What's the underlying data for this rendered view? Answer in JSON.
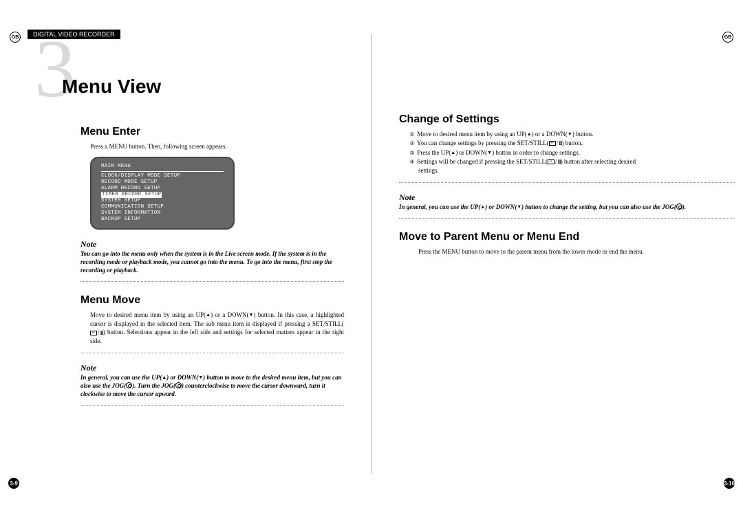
{
  "header": {
    "lang_label": "GB",
    "doc_title": "DIGITAL VIDEO RECORDER"
  },
  "chapter": {
    "number": "3",
    "title": "Menu View"
  },
  "page_numbers": {
    "left": "3-9",
    "right": "3-10"
  },
  "left": {
    "section1": {
      "title": "Menu Enter",
      "text": "Press a MENU button. Then, following screen appears.",
      "monitor": {
        "title": "MAIN MENU",
        "lines": [
          "CLOCK/DISPLAY MODE SETUP",
          "RECORD MODE SETUP",
          "ALARM RECORD SETUP",
          "TIMER RECORD SETUP",
          "SYSTEM SETUP",
          "COMMUNICATION SETUP",
          "SYSTEM INFORMATION",
          "BACKUP SETUP"
        ],
        "highlight_index": 3
      },
      "note_label": "Note",
      "note_text": "You can go into the menu only when the system is in the Live screen mode. If the system is in the recording mode or playback mode, you cannot go into the menu. To go into the menu, first stop the recording or playback."
    },
    "section2": {
      "title": "Menu Move",
      "text_a": "Move to desired menu item by using an UP(",
      "text_b": ") or a DOWN(",
      "text_c": ") button. In this case, a highlighted cursor is displayed in the selected item. The sub menu item is displayed if pressing a SET/STILL(",
      "text_d": ") button. Selections appear in the left side and settings for selected matters appear in the right side.",
      "note_label": "Note",
      "note_a": "In general, you can use the UP(",
      "note_b": ") or DOWN(",
      "note_c": ") button to move to the desired menu item, but you can also use the JOG(",
      "note_d": "). Turn the JOG(",
      "note_e": ") counterclockwise to move the cursor downward, turn it clockwise to move the cursor upward."
    }
  },
  "right": {
    "section1": {
      "title": "Change of Settings",
      "line1a": "Move to desired menu item by using an UP(",
      "line1b": ") or a DOWN(",
      "line1c": ") button.",
      "line2a": "You can change settings by pressing the SET/STILL(",
      "line2b": ") button.",
      "line3a": "Press the UP(",
      "line3b": ") or DOWN(",
      "line3c": ") button in order to change settings.",
      "line4a": "Settings will be changed if pressing the SET/STILL(",
      "line4b": ") button after selecting desired",
      "line4c": "settings.",
      "note_label": "Note",
      "note_a": "In general, you can use the UP(",
      "note_b": ") or DOWN(",
      "note_c": ") button to change the setting, but you can also use the JOG(",
      "note_d": ")."
    },
    "section2": {
      "title": "Move to Parent Menu or Menu End",
      "text": "Press the MENU button to move to the parent menu from the lower mode or end the menu."
    }
  },
  "icons": {
    "up": "▲",
    "down": "▼",
    "enter": "↵",
    "pause": "II",
    "circled": [
      "①",
      "②",
      "③",
      "④"
    ]
  }
}
